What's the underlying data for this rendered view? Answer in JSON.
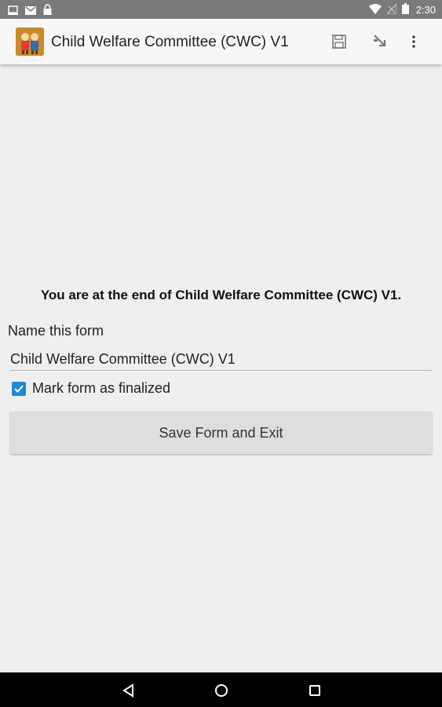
{
  "status_bar": {
    "time": "2:30",
    "left_icons": [
      "screenshot-icon",
      "email-icon",
      "lock-icon"
    ],
    "right_icons": [
      "wifi-icon",
      "no-signal-icon",
      "battery-icon"
    ]
  },
  "app_bar": {
    "title": "Child Welfare Committee (CWC) V1",
    "actions": [
      "save-icon",
      "jump-icon",
      "overflow-menu-icon"
    ]
  },
  "form_end": {
    "message": "You are at the end of Child Welfare Committee (CWC) V1.",
    "name_label": "Name this form",
    "name_value": "Child Welfare Committee (CWC) V1",
    "finalize_label": "Mark form as finalized",
    "finalized": true,
    "save_button_label": "Save Form and Exit"
  },
  "colors": {
    "accent": "#1e88d2",
    "status_bar": "#7a7a7a",
    "background": "#efefef"
  }
}
